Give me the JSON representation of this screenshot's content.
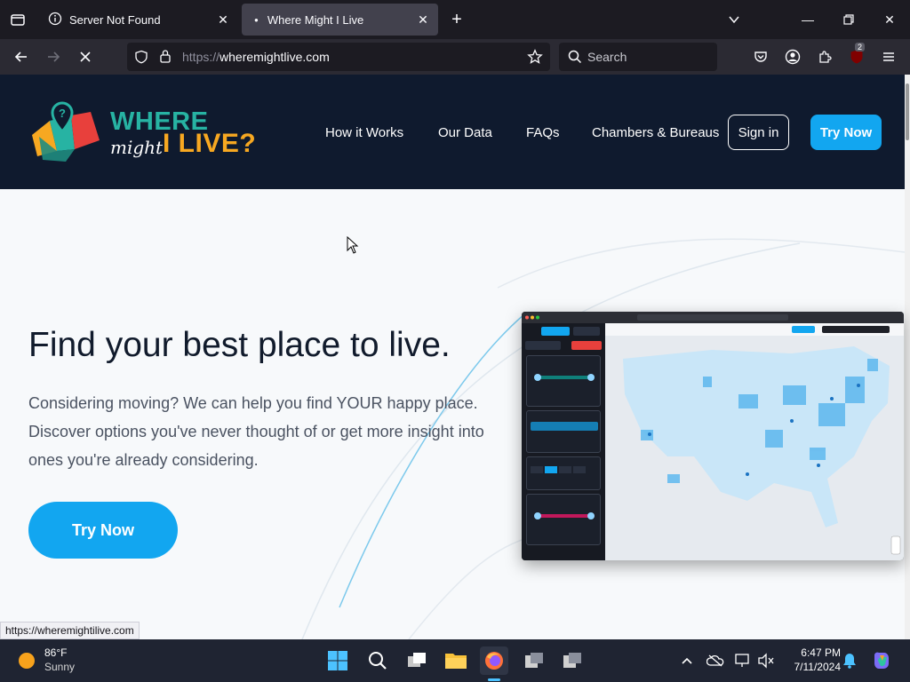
{
  "browser": {
    "tabs": [
      {
        "title": "Server Not Found",
        "active": false
      },
      {
        "title": "Where Might I Live",
        "active": true
      }
    ],
    "url_protocol": "https://",
    "url_host": "wheremightlive.com",
    "search_placeholder": "Search",
    "extension_badge": "2",
    "status_url": "https://wheremightilive.com"
  },
  "site": {
    "logo": {
      "where": "WHERE",
      "might": "might",
      "ilive": "I LIVE?"
    },
    "nav": [
      "How it Works",
      "Our Data",
      "FAQs",
      "Chambers & Bureaus"
    ],
    "signin": "Sign in",
    "try_now": "Try Now"
  },
  "hero": {
    "title": "Find your best place to live.",
    "body": "Considering moving? We can help you find YOUR happy place. Discover options you've never thought of or get more insight into ones you're already considering.",
    "cta": "Try Now"
  },
  "taskbar": {
    "temp": "86°F",
    "condition": "Sunny",
    "time": "6:47 PM",
    "date": "7/11/2024"
  },
  "colors": {
    "header_bg": "#0f1a2e",
    "accent_blue": "#12a6f0",
    "logo_teal": "#27b3a3",
    "logo_orange": "#f7a821"
  }
}
